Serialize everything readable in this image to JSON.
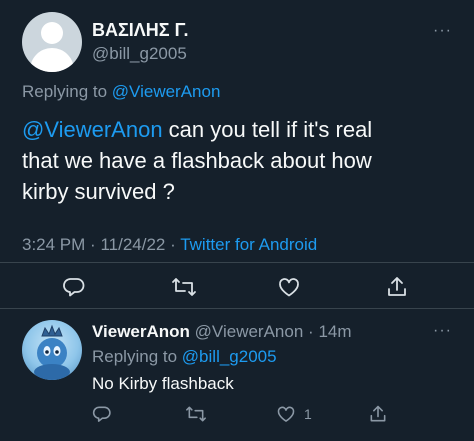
{
  "main_tweet": {
    "author_name": "ΒΑΣΙΛΗΣ Γ.",
    "author_handle": "@bill_g2005",
    "replying_label": "Replying to",
    "replying_to": "@ViewerAnon",
    "mention": "@ViewerAnon",
    "text_line1_rest": " can you tell if it's real",
    "text_line2": "that we have a flashback about how",
    "text_line3": "kirby survived ?",
    "time": "3:24 PM",
    "separator": "·",
    "date": "11/24/22",
    "source": "Twitter for Android",
    "more": "···"
  },
  "reply": {
    "author_name": "ViewerAnon",
    "author_handle": "@ViewerAnon",
    "separator": "·",
    "age": "14m",
    "replying_label": "Replying to",
    "replying_to": "@bill_g2005",
    "text": "No Kirby flashback",
    "like_count": "1",
    "more": "···"
  },
  "icons": {
    "reply": "reply-icon",
    "retweet": "retweet-icon",
    "like": "heart-icon",
    "share": "share-icon"
  },
  "colors": {
    "background": "#15202b",
    "text": "#f7f9f9",
    "muted": "#8b98a5",
    "accent": "#1d9bf0",
    "divider": "#38444d"
  }
}
